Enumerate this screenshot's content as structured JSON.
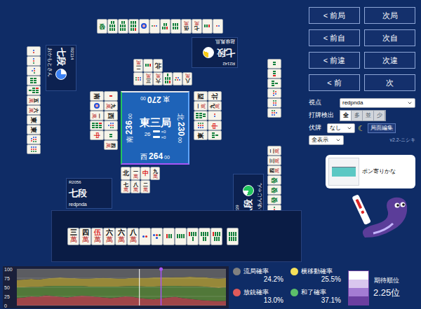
{
  "board": {
    "round": {
      "name": "東三局",
      "remaining": "26",
      "sticks": [
        {
          "count": "×0"
        },
        {
          "count": "×0"
        }
      ]
    },
    "seats": [
      {
        "side": "top",
        "wind": "東",
        "score": "270",
        "unit": "00"
      },
      {
        "side": "left",
        "wind": "南",
        "score": "236",
        "unit": "00"
      },
      {
        "side": "right",
        "wind": "北",
        "score": "230",
        "unit": "00"
      },
      {
        "side": "bottom",
        "wind": "西",
        "score": "264",
        "unit": "00"
      }
    ],
    "players": {
      "top": {
        "rank": "七段",
        "rating": "R2142",
        "name": "超級鳳凰",
        "clock_level": 0.3,
        "clock_color": "#facc15",
        "hand": [
          {
            "kind": "honor",
            "text": "發",
            "color": "#15803d"
          },
          {
            "kind": "sou",
            "pips": 8
          },
          {
            "kind": "sou",
            "pips": 8
          },
          {
            "kind": "sou",
            "pips": 9
          },
          {
            "kind": "pin",
            "pips": 1
          },
          {
            "kind": "pin",
            "pips": 3
          },
          {
            "kind": "sou",
            "pips": 5
          },
          {
            "kind": "sou",
            "pips": 6
          },
          {
            "kind": "man",
            "rank": "伍",
            "suit": "萬",
            "red": false
          },
          {
            "kind": "man",
            "rank": "七",
            "suit": "萬",
            "red": false
          },
          {
            "kind": "sou",
            "pips": 3
          },
          {
            "kind": "pin",
            "pips": 2
          }
        ],
        "discards": [
          [
            {
              "kind": "man",
              "rank": "八",
              "suit": "萬",
              "red": false
            },
            {
              "kind": "pin",
              "pips": 5
            },
            {
              "kind": "sou",
              "pips": 7
            },
            {
              "kind": "man",
              "rank": "六",
              "suit": "萬",
              "red": false
            },
            {
              "kind": "man",
              "rank": "三",
              "suit": "萬",
              "red": false
            },
            {
              "kind": "pin",
              "pips": 6
            }
          ],
          [
            {
              "kind": "honor",
              "text": "北",
              "color": "#111111"
            },
            {
              "kind": "sou",
              "pips": 3
            },
            {
              "kind": "man",
              "rank": "二",
              "suit": "萬",
              "red": false
            }
          ]
        ]
      },
      "left": {
        "rank": "七段",
        "rating": "R2114",
        "name": "おかもとさん",
        "clock_level": 0.75,
        "clock_color": "#3b82f6",
        "hand": [
          {
            "kind": "pin",
            "pips": 2
          },
          {
            "kind": "pin",
            "pips": 3
          },
          {
            "kind": "pin",
            "pips": 4
          },
          {
            "kind": "sou",
            "pips": 6
          },
          {
            "kind": "sou",
            "pips": 7
          },
          {
            "kind": "man",
            "rank": "五",
            "suit": "萬",
            "red": false
          },
          {
            "kind": "man",
            "rank": "六",
            "suit": "萬",
            "red": false
          },
          {
            "kind": "honor",
            "text": "東",
            "color": "#111111"
          },
          {
            "kind": "honor",
            "text": "東",
            "color": "#111111"
          },
          {
            "kind": "pin",
            "pips": 8
          },
          {
            "kind": "pin",
            "pips": 9
          }
        ],
        "discards": [
          [
            {
              "kind": "sou",
              "pips": 1
            },
            {
              "kind": "man",
              "rank": "九",
              "suit": "萬",
              "red": false
            },
            {
              "kind": "honor",
              "text": "西",
              "color": "#111111"
            },
            {
              "kind": "pin",
              "pips": 7
            },
            {
              "kind": "sou",
              "pips": 2
            },
            {
              "kind": "man",
              "rank": "四",
              "suit": "萬",
              "red": false
            }
          ],
          [
            {
              "kind": "honor",
              "text": "南",
              "color": "#111111"
            },
            {
              "kind": "pin",
              "pips": 1
            },
            {
              "kind": "man",
              "rank": "一",
              "suit": "萬",
              "red": false
            },
            {
              "kind": "sou",
              "pips": 9
            },
            {
              "kind": "honor",
              "text": "中",
              "color": "#dc2626"
            }
          ]
        ]
      },
      "right": {
        "rank": "八段",
        "rating": "R2229",
        "name": "らいあんじゃん",
        "clock_level": 0.8,
        "clock_color": "#22c55e",
        "hand": [
          {
            "kind": "sou",
            "pips": 2
          },
          {
            "kind": "sou",
            "pips": 3
          },
          {
            "kind": "sou",
            "pips": 4
          },
          {
            "kind": "pin",
            "pips": 5
          },
          {
            "kind": "pin",
            "pips": 6
          },
          {
            "kind": "pin",
            "pips": 7
          }
        ],
        "melds": [
          {
            "kind": "man",
            "rank": "二",
            "suit": "萬",
            "red": false
          },
          {
            "kind": "man",
            "rank": "三",
            "suit": "萬",
            "red": false
          },
          {
            "kind": "man",
            "rank": "四",
            "suit": "萬",
            "red": false
          },
          {
            "kind": "honor",
            "text": "發",
            "color": "#15803d"
          },
          {
            "kind": "honor",
            "text": "發",
            "color": "#15803d"
          },
          {
            "kind": "honor",
            "text": "發",
            "color": "#15803d"
          },
          {
            "kind": "pin",
            "pips": 3
          },
          {
            "kind": "pin",
            "pips": 3
          }
        ],
        "discards": [
          [
            {
              "kind": "honor",
              "text": "東",
              "color": "#111111"
            },
            {
              "kind": "pin",
              "pips": 9
            },
            {
              "kind": "sou",
              "pips": 8
            },
            {
              "kind": "man",
              "rank": "一",
              "suit": "萬",
              "red": false
            },
            {
              "kind": "honor",
              "text": "西",
              "color": "#111111"
            }
          ],
          [
            {
              "kind": "sou",
              "pips": 4
            },
            {
              "kind": "honor",
              "text": "中",
              "color": "#dc2626"
            },
            {
              "kind": "pin",
              "pips": 2
            },
            {
              "kind": "man",
              "rank": "九",
              "suit": "萬",
              "red": false
            },
            {
              "kind": "honor",
              "text": "北",
              "color": "#111111"
            }
          ]
        ]
      },
      "bottom": {
        "rank": "七段",
        "rating": "R2056",
        "name": "redpnda",
        "hand": [
          {
            "kind": "man",
            "rank": "三",
            "suit": "萬",
            "red": false
          },
          {
            "kind": "man",
            "rank": "四",
            "suit": "萬",
            "red": false
          },
          {
            "kind": "man",
            "rank": "伍",
            "suit": "萬",
            "red": true
          },
          {
            "kind": "man",
            "rank": "六",
            "suit": "萬",
            "red": false
          },
          {
            "kind": "man",
            "rank": "六",
            "suit": "萬",
            "red": false
          },
          {
            "kind": "man",
            "rank": "八",
            "suit": "萬",
            "red": false
          },
          {
            "kind": "pin",
            "pips": 2
          },
          {
            "kind": "pin",
            "pips": 4
          },
          {
            "kind": "sou",
            "pips": 3
          },
          {
            "kind": "sou",
            "pips": 4
          },
          {
            "kind": "sou",
            "pips": 5
          },
          {
            "kind": "sou",
            "pips": 6
          },
          {
            "kind": "sou",
            "pips": 7
          }
        ],
        "drawn": {
          "kind": "sou",
          "pips": 8
        },
        "discards": [
          [
            {
              "kind": "honor",
              "text": "北",
              "color": "#111111"
            },
            {
              "kind": "man",
              "rank": "一",
              "suit": "萬",
              "red": false
            },
            {
              "kind": "honor",
              "text": "中",
              "color": "#dc2626"
            },
            {
              "kind": "man",
              "rank": "九",
              "suit": "萬",
              "red": false
            }
          ],
          [
            {
              "kind": "man",
              "rank": "七",
              "suit": "萬",
              "red": false
            },
            {
              "kind": "man",
              "rank": "八",
              "suit": "萬",
              "red": false
            },
            {
              "kind": "man",
              "rank": "二",
              "suit": "萬",
              "red": false
            }
          ]
        ]
      }
    }
  },
  "nav_buttons": [
    {
      "prev": "< 前局",
      "next": "次局"
    },
    {
      "prev": "< 前自",
      "next": "次自"
    },
    {
      "prev": "< 前違",
      "next": "次違"
    },
    {
      "prev": "< 前",
      "next": "次"
    }
  ],
  "controls": {
    "viewpoint": {
      "label": "視点",
      "value": "redpnda"
    },
    "detection": {
      "label": "打牌検出",
      "options": [
        {
          "label": "全",
          "selected": true
        },
        {
          "label": "多",
          "selected": false
        },
        {
          "label": "並",
          "selected": false
        },
        {
          "label": "少",
          "selected": false
        }
      ]
    },
    "hidden": {
      "label": "伏牌",
      "value": "なし"
    },
    "theme_icon": "☾",
    "edit": "局面編集",
    "display": {
      "value": "全表示"
    },
    "version": "v2.2-ニシキ"
  },
  "bubble": {
    "text": "ポン寄りかな",
    "bar_level": 0.35
  },
  "chart": {
    "y_ticks": [
      "100",
      "75",
      "50",
      "25",
      "0"
    ],
    "cursor_index": 17,
    "marker_index": 20,
    "series": [
      {
        "color": "#c0504d",
        "values": [
          20,
          22,
          25,
          24,
          28,
          26,
          24,
          22,
          25,
          27,
          26,
          24,
          22,
          20,
          22,
          25,
          24,
          20,
          18,
          17,
          19,
          22,
          24,
          20,
          18,
          16,
          14,
          13,
          12,
          13
        ]
      },
      {
        "color": "#5f8f3a",
        "values": [
          30,
          28,
          26,
          27,
          25,
          28,
          30,
          32,
          29,
          27,
          26,
          28,
          30,
          32,
          30,
          28,
          30,
          33,
          34,
          35,
          34,
          32,
          30,
          33,
          35,
          37,
          38,
          37,
          36,
          37
        ]
      },
      {
        "color": "#b7a33a",
        "values": [
          20,
          21,
          22,
          20,
          21,
          22,
          23,
          22,
          21,
          20,
          22,
          23,
          24,
          23,
          22,
          21,
          22,
          23,
          24,
          25,
          24,
          23,
          24,
          25,
          26,
          25,
          26,
          25,
          26,
          25
        ]
      },
      {
        "color": "#6b6b6b",
        "values": [
          30,
          29,
          27,
          29,
          26,
          24,
          23,
          24,
          25,
          26,
          26,
          25,
          24,
          25,
          26,
          26,
          24,
          24,
          24,
          23,
          23,
          23,
          22,
          22,
          21,
          22,
          22,
          25,
          26,
          25
        ]
      }
    ]
  },
  "legend": [
    {
      "label": "流局確率",
      "value": "24.2%",
      "color": "#808080"
    },
    {
      "label": "横移動確率",
      "value": "25.5%",
      "color": "#f5e05a"
    },
    {
      "label": "放銃確率",
      "value": "13.0%",
      "color": "#e05a5a"
    },
    {
      "label": "和了確率",
      "value": "37.1%",
      "color": "#5cbf6a"
    }
  ],
  "expected_rank": {
    "label": "期待順位",
    "value": "2.25位"
  }
}
